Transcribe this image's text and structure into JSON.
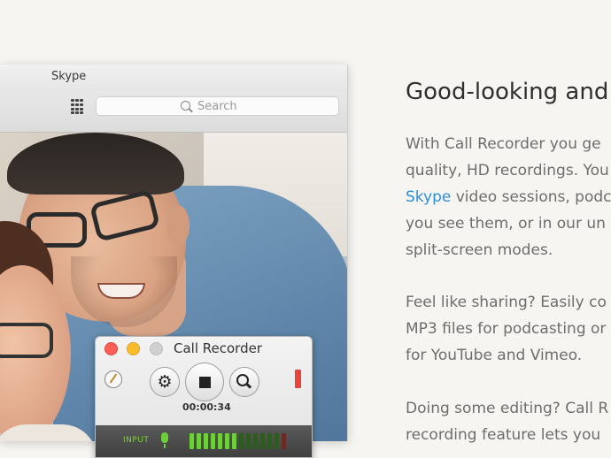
{
  "skype": {
    "title": "Skype",
    "search_placeholder": "Search"
  },
  "recorder": {
    "title": "Call Recorder",
    "timer": "00:00:34",
    "input_label": "INPUT",
    "meter_level": 0.5
  },
  "article": {
    "headline": "Good-looking and",
    "p1_line1": "With Call Recorder you ge",
    "p1_line2": "quality, HD recordings. You",
    "p1_link": "Skype",
    "p1_line3_rest": " video sessions, podc",
    "p1_line4": "you see them, or in our un",
    "p1_line5": "split-screen modes.",
    "p2_line1": "Feel like sharing? Easily co",
    "p2_line2": "MP3 files for podcasting or",
    "p2_line3": "for YouTube and Vimeo.",
    "p3_line1": "Doing some editing? Call R",
    "p3_line2": "recording feature lets you"
  },
  "colors": {
    "link": "#2c8fd6",
    "close": "#fc5f57",
    "minimize": "#fdbc2e",
    "meter_on": "#6fcf3a",
    "record_level": "#e8443a"
  }
}
